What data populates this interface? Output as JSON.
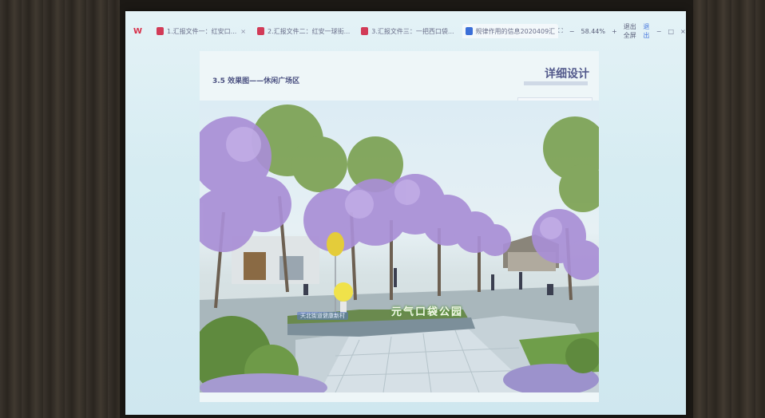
{
  "window": {
    "tabs": [
      {
        "label": "1.汇报文件一：红安口...",
        "icon_color": "#d23b57",
        "active": false
      },
      {
        "label": "2.汇报文件二：红安一球街...",
        "icon_color": "#d23b57",
        "active": false
      },
      {
        "label": "3.汇报文件三：一把西口袋...",
        "icon_color": "#d23b57",
        "active": false
      },
      {
        "label": "规律作用的信息2020409汇",
        "icon_color": "#3b6fd8",
        "active": true
      }
    ],
    "zoom_value": "58.44%",
    "zoom_minus": "−",
    "zoom_plus": "+",
    "fullscreen_label": "退出全屏",
    "exit_label": "退出",
    "minimize_glyph": "−",
    "maximize_glyph": "□",
    "close_glyph": "×"
  },
  "slide": {
    "heading": "3.5 效果图——休闲广场区",
    "corner_title": "详细设计",
    "sign_main": "元气口袋公园",
    "sign_sub": "天北街道健康新村"
  },
  "colors": {
    "accent": "#4a7adf",
    "title": "#535a8c"
  }
}
